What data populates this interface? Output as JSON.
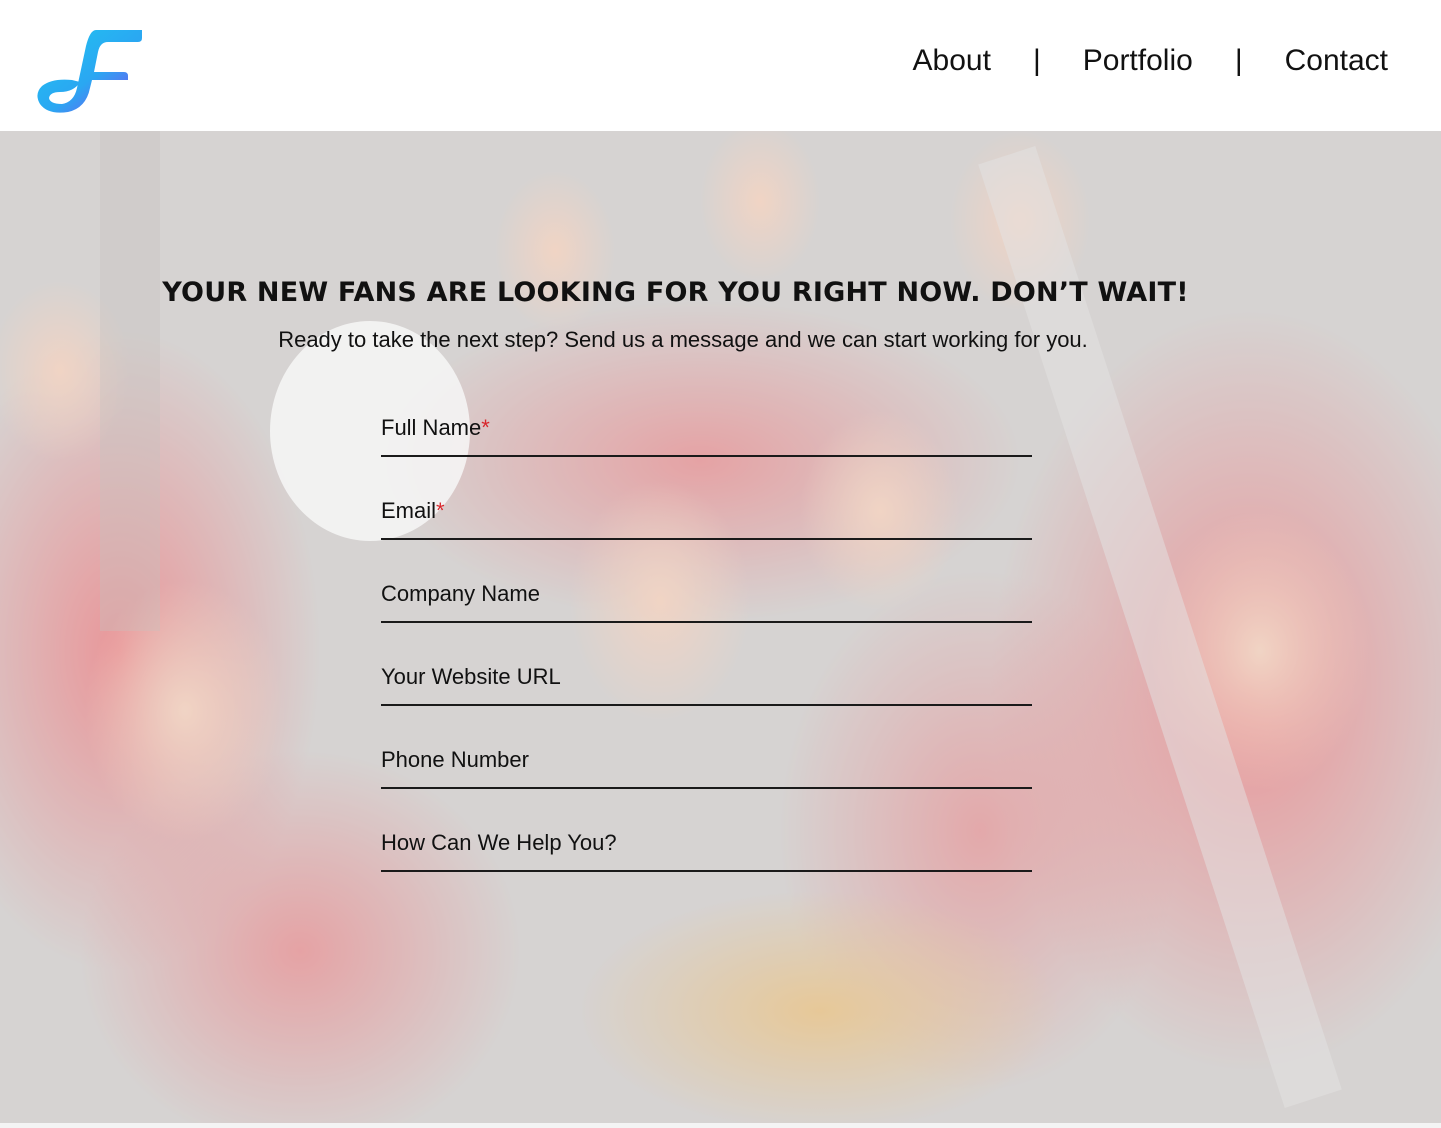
{
  "brand": {
    "logo_letter": "F",
    "colors": {
      "cyan": "#21c6f0",
      "purple": "#8b3df0"
    }
  },
  "nav": {
    "items": [
      {
        "label": "About"
      },
      {
        "label": "Portfolio"
      },
      {
        "label": "Contact"
      }
    ],
    "separator": "|"
  },
  "hero": {
    "headline": "YOUR NEW FANS ARE LOOKING FOR YOU RIGHT NOW. DON’T WAIT!",
    "subheadline": "Ready to take the next step? Send us a message and we can start working for you.",
    "background_description_icon": "crowd-photo"
  },
  "form": {
    "required_marker": "*",
    "required_color": "#d8262b",
    "fields": [
      {
        "label": "Full Name",
        "required": true
      },
      {
        "label": "Email",
        "required": true
      },
      {
        "label": "Company Name",
        "required": false
      },
      {
        "label": "Your Website URL",
        "required": false
      },
      {
        "label": "Phone Number",
        "required": false
      },
      {
        "label": "How Can We Help You?",
        "required": false
      }
    ]
  }
}
